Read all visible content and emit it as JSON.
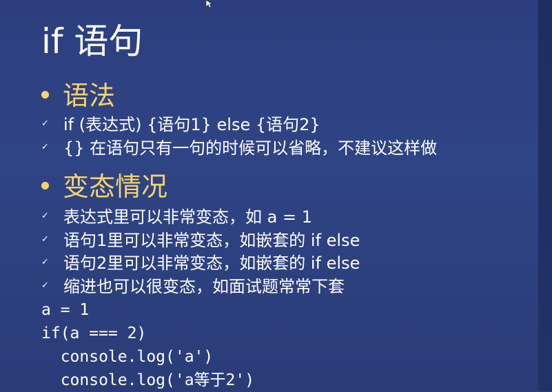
{
  "slide": {
    "title": "if 语句",
    "sections": [
      {
        "heading": "语法",
        "items": [
          "if (表达式) {语句1} else {语句2}",
          "{} 在语句只有一句的时候可以省略，不建议这样做"
        ]
      },
      {
        "heading": "变态情况",
        "items": [
          "表达式里可以非常变态，如 a = 1",
          "语句1里可以非常变态，如嵌套的 if else",
          "语句2里可以非常变态，如嵌套的 if else",
          "缩进也可以很变态，如面试题常常下套"
        ]
      }
    ],
    "code": [
      "a = 1",
      "if(a === 2)",
      "  console.log('a')",
      "  console.log('a等于2')"
    ]
  },
  "colors": {
    "background": "#2f4485",
    "heading": "#f6d36a",
    "text": "#ffffff"
  },
  "icons": {
    "bullet": "dot-icon",
    "item_marker": "check-icon",
    "pointer": "cursor-icon"
  }
}
